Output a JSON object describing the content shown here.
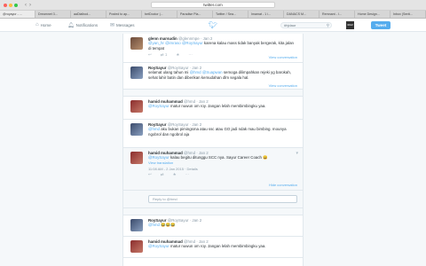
{
  "browser": {
    "url": "twitter.com",
    "tabs": [
      "@royayur - ...",
      "Dreamnet 3...",
      "aaDialbod...",
      "Posted to ap...",
      "betDoctor |...",
      "Paradise Pla...",
      "Twitter / Sea...",
      "Imamat - 1 i...",
      "DANACS M...",
      "Remnant - I...",
      "Home Design...",
      "Inbox (Senti..."
    ]
  },
  "nav": {
    "home": "Home",
    "notifications": "Notifications",
    "messages": "Messages",
    "search_placeholder": "#hjdaur",
    "tweet_button": "Tweet",
    "avatar_text": "IMAM"
  },
  "tweets": [
    {
      "name": "glenn marsudin",
      "handle": "@glennmpe",
      "time": "Jan 2",
      "text_mention": "@yan_hr @imraso @RoySayur",
      "text": " karena kalau mass tidak banyak bergerak, kita jalan di tempat",
      "counts": "1",
      "link": "View conversation"
    },
    {
      "name": "RoySayur",
      "handle": "@RoySayur",
      "time": "Jan 2",
      "text": "selamat ulang tahun mi ",
      "text_mention": "@hmd @Suapwan",
      "text2": " semoga dilimpahkan rejeki yg barokah, sehat lahir batin dan diberikan kemudahan dlm segala hal.",
      "link": "View conversation"
    },
    {
      "name": "hamid muhammad",
      "handle": "@hmd",
      "time": "Jan 2",
      "text_mention": "@RoySayur",
      "text": " matur nuwun om roy. Jangan lelah membimbingku yaa."
    },
    {
      "name": "RoySayur",
      "handle": "@RoySayur",
      "time": "Jan 2",
      "text_mention": "@hmd",
      "text": " aku bukan pimingsma atau ssc atau GO jadi ndak mau bimbing. mounya ngobrol dan ngobrol aja"
    },
    {
      "name": "hamid muhammad",
      "handle": "@hmd",
      "time": "Jan 2",
      "text_mention": "@RoySayur",
      "text": " kalau begitu ditunggu SCC nya. Sayur Career Coach 😄",
      "translation": "View translation",
      "stamp": "11:08 AM - 2 Jan 2015 · Details",
      "link": "Hide conversation"
    },
    {
      "reply_placeholder": "Reply to @hmd"
    },
    {
      "name": "RoySayur",
      "handle": "@RoySayur",
      "time": "Jan 2",
      "text_mention": "@hmd",
      "text": " 😂😂😂"
    },
    {
      "name": "hamid muhammad",
      "handle": "@hmd",
      "time": "Jan 2",
      "text_mention": "@RoySayur",
      "text": " matur nuwun om roy. Jangan lelah membimbingku yaa."
    }
  ]
}
